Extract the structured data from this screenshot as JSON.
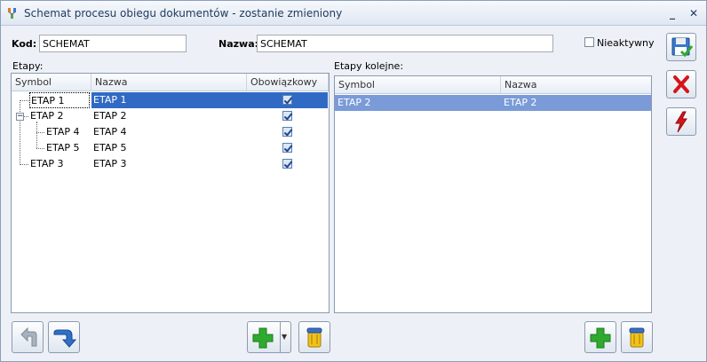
{
  "window": {
    "title": "Schemat procesu obiegu dokumentów - zostanie zmieniony"
  },
  "form": {
    "kod_label": "Kod:",
    "kod_value": "SCHEMAT",
    "nazwa_label": "Nazwa:",
    "nazwa_value": "SCHEMAT",
    "nieaktywny_label": "Nieaktywny",
    "nieaktywny_checked": false
  },
  "etapy": {
    "label": "Etapy:",
    "columns": [
      "Symbol",
      "Nazwa",
      "Obowiązkowy"
    ],
    "rows": [
      {
        "symbol": "ETAP 1",
        "nazwa": "ETAP 1",
        "obowiazkowy": true
      },
      {
        "symbol": "ETAP 2",
        "nazwa": "ETAP 2",
        "obowiazkowy": true
      },
      {
        "symbol": "ETAP 4",
        "nazwa": "ETAP 4",
        "obowiazkowy": true
      },
      {
        "symbol": "ETAP 5",
        "nazwa": "ETAP 5",
        "obowiazkowy": true
      },
      {
        "symbol": "ETAP 3",
        "nazwa": "ETAP 3",
        "obowiazkowy": true
      }
    ]
  },
  "etapy_kolejne": {
    "label": "Etapy kolejne:",
    "columns": [
      "Symbol",
      "Nazwa"
    ],
    "rows": [
      {
        "symbol": "ETAP 2",
        "nazwa": "ETAP 2"
      }
    ]
  },
  "colors": {
    "selection": "#316ac5",
    "selection_secondary": "#7a9bd8",
    "accent_green": "#2faa2f",
    "accent_red": "#d4161c"
  }
}
